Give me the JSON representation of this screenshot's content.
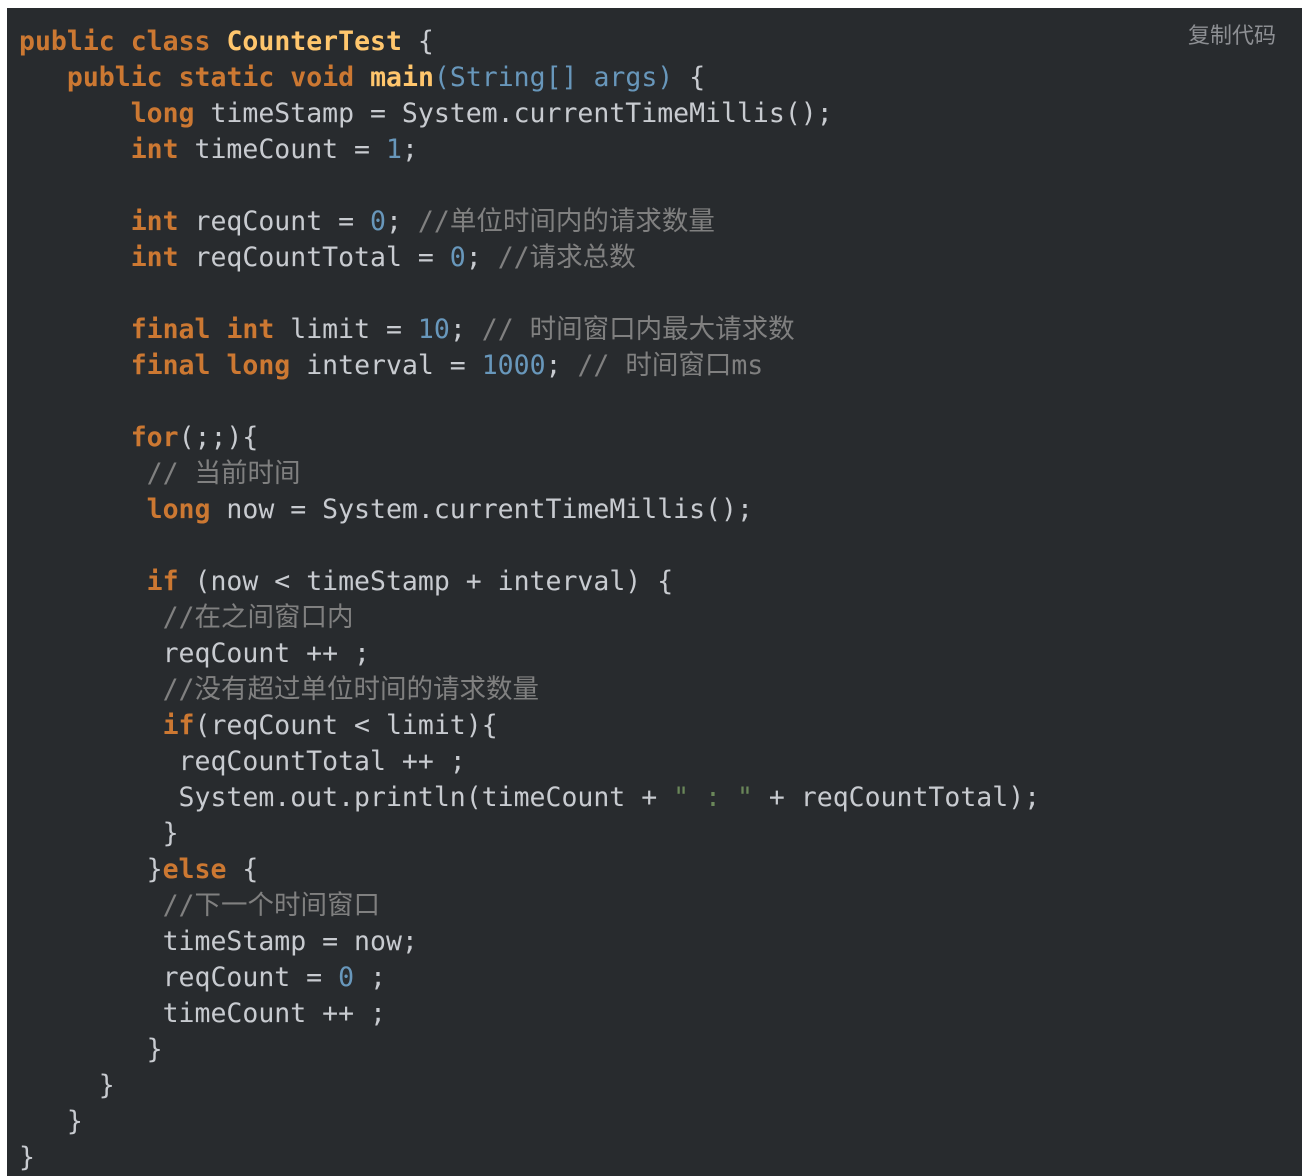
{
  "toolbar": {
    "copy_label": "复制代码"
  },
  "code": {
    "language": "java",
    "lines": [
      [
        {
          "t": "kw",
          "v": "public"
        },
        {
          "t": "p",
          "v": " "
        },
        {
          "t": "kw",
          "v": "class"
        },
        {
          "t": "p",
          "v": " "
        },
        {
          "t": "cls",
          "v": "CounterTest"
        },
        {
          "t": "p",
          "v": " {"
        }
      ],
      [
        {
          "t": "p",
          "v": "   "
        },
        {
          "t": "kw",
          "v": "public"
        },
        {
          "t": "p",
          "v": " "
        },
        {
          "t": "kw",
          "v": "static"
        },
        {
          "t": "p",
          "v": " "
        },
        {
          "t": "kw",
          "v": "void"
        },
        {
          "t": "p",
          "v": " "
        },
        {
          "t": "fn",
          "v": "main"
        },
        {
          "t": "param",
          "v": "(String[] args)"
        },
        {
          "t": "p",
          "v": " {"
        }
      ],
      [
        {
          "t": "p",
          "v": "       "
        },
        {
          "t": "kw",
          "v": "long"
        },
        {
          "t": "p",
          "v": " timeStamp = System.currentTimeMillis();"
        }
      ],
      [
        {
          "t": "p",
          "v": "       "
        },
        {
          "t": "kw",
          "v": "int"
        },
        {
          "t": "p",
          "v": " timeCount = "
        },
        {
          "t": "num",
          "v": "1"
        },
        {
          "t": "p",
          "v": ";"
        }
      ],
      [],
      [
        {
          "t": "p",
          "v": "       "
        },
        {
          "t": "kw",
          "v": "int"
        },
        {
          "t": "p",
          "v": " reqCount = "
        },
        {
          "t": "num",
          "v": "0"
        },
        {
          "t": "p",
          "v": "; "
        },
        {
          "t": "cm",
          "v": "//单位时间内的请求数量"
        }
      ],
      [
        {
          "t": "p",
          "v": "       "
        },
        {
          "t": "kw",
          "v": "int"
        },
        {
          "t": "p",
          "v": " reqCountTotal = "
        },
        {
          "t": "num",
          "v": "0"
        },
        {
          "t": "p",
          "v": "; "
        },
        {
          "t": "cm",
          "v": "//请求总数"
        }
      ],
      [],
      [
        {
          "t": "p",
          "v": "       "
        },
        {
          "t": "kw",
          "v": "final"
        },
        {
          "t": "p",
          "v": " "
        },
        {
          "t": "kw",
          "v": "int"
        },
        {
          "t": "p",
          "v": " limit = "
        },
        {
          "t": "num",
          "v": "10"
        },
        {
          "t": "p",
          "v": "; "
        },
        {
          "t": "cm",
          "v": "// 时间窗口内最大请求数"
        }
      ],
      [
        {
          "t": "p",
          "v": "       "
        },
        {
          "t": "kw",
          "v": "final"
        },
        {
          "t": "p",
          "v": " "
        },
        {
          "t": "kw",
          "v": "long"
        },
        {
          "t": "p",
          "v": " interval = "
        },
        {
          "t": "num",
          "v": "1000"
        },
        {
          "t": "p",
          "v": "; "
        },
        {
          "t": "cm",
          "v": "// 时间窗口ms"
        }
      ],
      [],
      [
        {
          "t": "p",
          "v": "       "
        },
        {
          "t": "kw",
          "v": "for"
        },
        {
          "t": "p",
          "v": "(;;){"
        }
      ],
      [
        {
          "t": "p",
          "v": "        "
        },
        {
          "t": "cm",
          "v": "// 当前时间"
        }
      ],
      [
        {
          "t": "p",
          "v": "        "
        },
        {
          "t": "kw",
          "v": "long"
        },
        {
          "t": "p",
          "v": " now = System.currentTimeMillis();"
        }
      ],
      [],
      [
        {
          "t": "p",
          "v": "        "
        },
        {
          "t": "kw",
          "v": "if"
        },
        {
          "t": "p",
          "v": " (now < timeStamp + interval) {"
        }
      ],
      [
        {
          "t": "p",
          "v": "         "
        },
        {
          "t": "cm",
          "v": "//在之间窗口内"
        }
      ],
      [
        {
          "t": "p",
          "v": "         reqCount ++ ;"
        }
      ],
      [
        {
          "t": "p",
          "v": "         "
        },
        {
          "t": "cm",
          "v": "//没有超过单位时间的请求数量"
        }
      ],
      [
        {
          "t": "p",
          "v": "         "
        },
        {
          "t": "kw",
          "v": "if"
        },
        {
          "t": "p",
          "v": "(reqCount < limit){"
        }
      ],
      [
        {
          "t": "p",
          "v": "          reqCountTotal ++ ;"
        }
      ],
      [
        {
          "t": "p",
          "v": "          System.out.println(timeCount + "
        },
        {
          "t": "str",
          "v": "\" : \""
        },
        {
          "t": "p",
          "v": " + reqCountTotal);"
        }
      ],
      [
        {
          "t": "p",
          "v": "         }"
        }
      ],
      [
        {
          "t": "p",
          "v": "        }"
        },
        {
          "t": "kw",
          "v": "else"
        },
        {
          "t": "p",
          "v": " {"
        }
      ],
      [
        {
          "t": "p",
          "v": "         "
        },
        {
          "t": "cm",
          "v": "//下一个时间窗口"
        }
      ],
      [
        {
          "t": "p",
          "v": "         timeStamp = now;"
        }
      ],
      [
        {
          "t": "p",
          "v": "         reqCount = "
        },
        {
          "t": "num",
          "v": "0"
        },
        {
          "t": "p",
          "v": " ;"
        }
      ],
      [
        {
          "t": "p",
          "v": "         timeCount ++ ;"
        }
      ],
      [
        {
          "t": "p",
          "v": "        }"
        }
      ],
      [
        {
          "t": "p",
          "v": "     }"
        }
      ],
      [
        {
          "t": "p",
          "v": "   }"
        }
      ],
      [
        {
          "t": "p",
          "v": "}"
        }
      ]
    ]
  }
}
